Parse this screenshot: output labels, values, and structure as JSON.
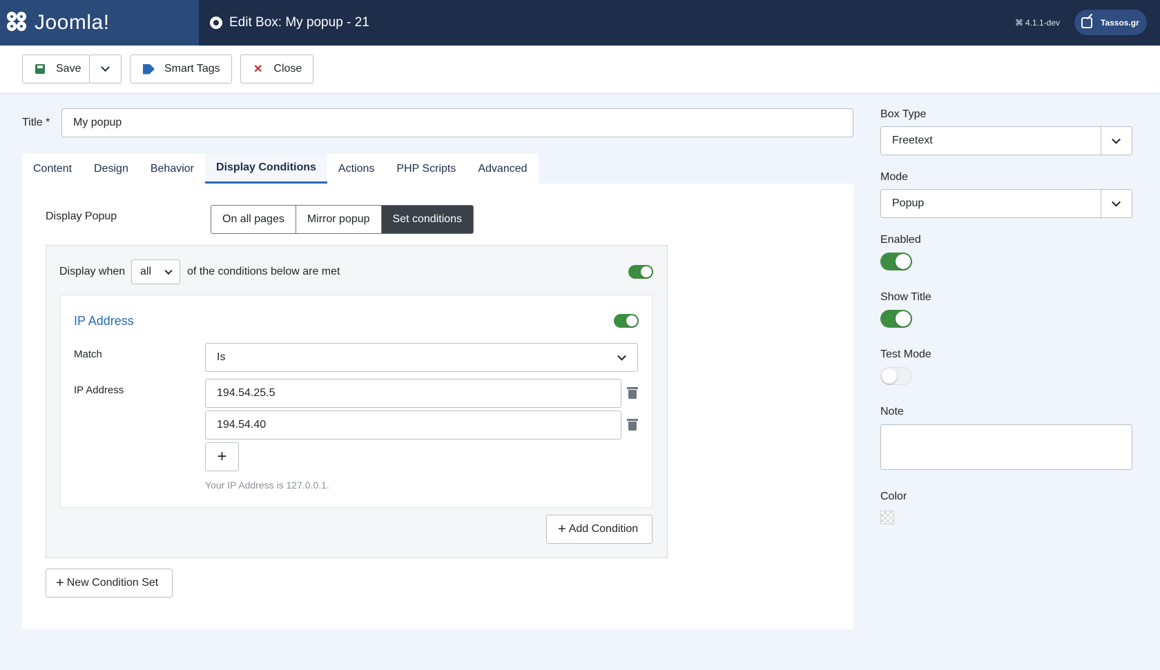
{
  "header": {
    "logo_text": "Joomla!",
    "title": "Edit Box: My popup - 21",
    "version": "4.1.1-dev",
    "site_label": "Tassos.gr"
  },
  "toolbar": {
    "save": "Save",
    "smart_tags": "Smart Tags",
    "close": "Close"
  },
  "form": {
    "title_label": "Title *",
    "title_value": "My popup"
  },
  "tabs": [
    "Content",
    "Design",
    "Behavior",
    "Display Conditions",
    "Actions",
    "PHP Scripts",
    "Advanced"
  ],
  "active_tab": "Display Conditions",
  "display": {
    "label": "Display Popup",
    "options": [
      "On all pages",
      "Mirror popup",
      "Set conditions"
    ],
    "selected": "Set conditions"
  },
  "condition_set": {
    "prefix": "Display when",
    "match": "all",
    "suffix": "of the conditions below are met",
    "enabled": true
  },
  "condition": {
    "title": "IP Address",
    "enabled": true,
    "match_label": "Match",
    "match_value": "Is",
    "ip_label": "IP Address",
    "ips": [
      "194.54.25.5",
      "194.54.40"
    ],
    "hint": "Your IP Address is 127.0.0.1.",
    "add_condition": "Add Condition"
  },
  "new_condition_set": "New Condition Set",
  "sidebar": {
    "box_type_label": "Box Type",
    "box_type": "Freetext",
    "mode_label": "Mode",
    "mode": "Popup",
    "enabled_label": "Enabled",
    "enabled": true,
    "show_title_label": "Show Title",
    "show_title": true,
    "test_mode_label": "Test Mode",
    "test_mode": false,
    "note_label": "Note",
    "note": "",
    "color_label": "Color"
  },
  "colors": {
    "header": "#1d2d4a",
    "accent": "#2a69b8",
    "toggle_on": "#3e8e41"
  }
}
